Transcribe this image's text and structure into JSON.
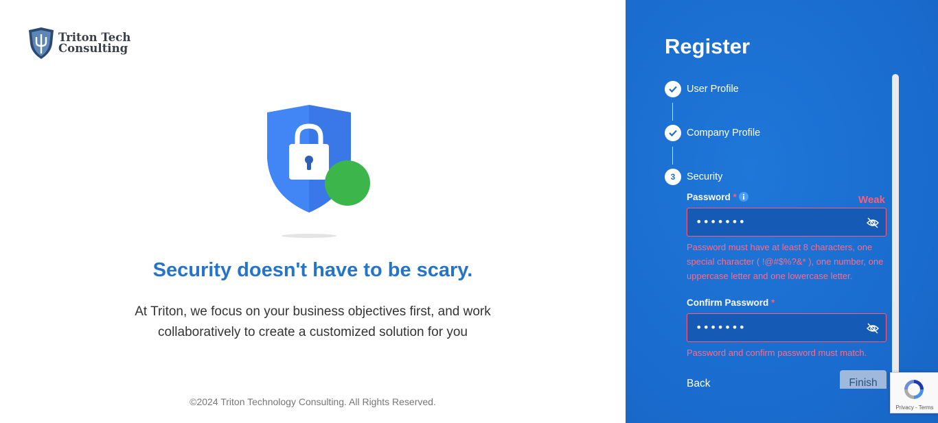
{
  "brand": {
    "line1": "Triton Tech",
    "line2": "Consulting"
  },
  "hero": {
    "headline": "Security doesn't have to be scary.",
    "subtext_line1": "At Triton, we focus on your business objectives first, and work",
    "subtext_line2": "collaboratively to create a customized solution for you"
  },
  "footer": {
    "copyright": "©2024 Triton Technology Consulting. All Rights Reserved."
  },
  "register": {
    "title": "Register",
    "steps": [
      {
        "label": "User Profile",
        "status": "complete",
        "icon": "check-icon"
      },
      {
        "label": "Company Profile",
        "status": "complete",
        "icon": "check-icon"
      },
      {
        "label": "Security",
        "status": "active",
        "number": "3"
      }
    ],
    "password": {
      "label": "Password",
      "required_mark": "*",
      "strength": "Weak",
      "value_masked": "•••••••",
      "error_line1": "Password must have at least 8 characters, one",
      "error_line2": "special character ( !@#$%?&* ), one number, one",
      "error_line3": "uppercase letter and one lowercase letter."
    },
    "confirm_password": {
      "label": "Confirm Password",
      "required_mark": "*",
      "value_masked": "•••••••",
      "error": "Password and confirm password must match."
    },
    "back_label": "Back",
    "finish_label": "Finish"
  },
  "recaptcha": {
    "links": "Privacy - Terms"
  },
  "colors": {
    "panel_blue": "#1a6fd0",
    "headline_blue": "#2674c8",
    "error_pink": "#ff5c7a",
    "shield_blue": "#4285f4",
    "badge_green": "#3cb54a"
  }
}
